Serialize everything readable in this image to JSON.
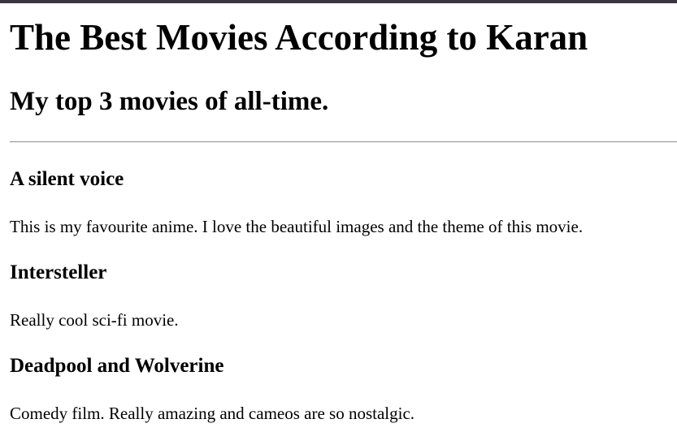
{
  "page": {
    "title": "The Best Movies According to Karan",
    "subtitle": "My top 3 movies of all-time."
  },
  "movies": [
    {
      "title": "A silent voice",
      "description": "This is my favourite anime. I love the beautiful images and the theme of this movie."
    },
    {
      "title": "Intersteller",
      "description": "Really cool sci-fi movie."
    },
    {
      "title": "Deadpool and Wolverine",
      "description": "Comedy film. Really amazing and cameos are so nostalgic."
    }
  ],
  "colors": {
    "top_bar": "#3a3442",
    "divider": "#9a9a9a",
    "text": "#000000",
    "background": "#ffffff"
  }
}
